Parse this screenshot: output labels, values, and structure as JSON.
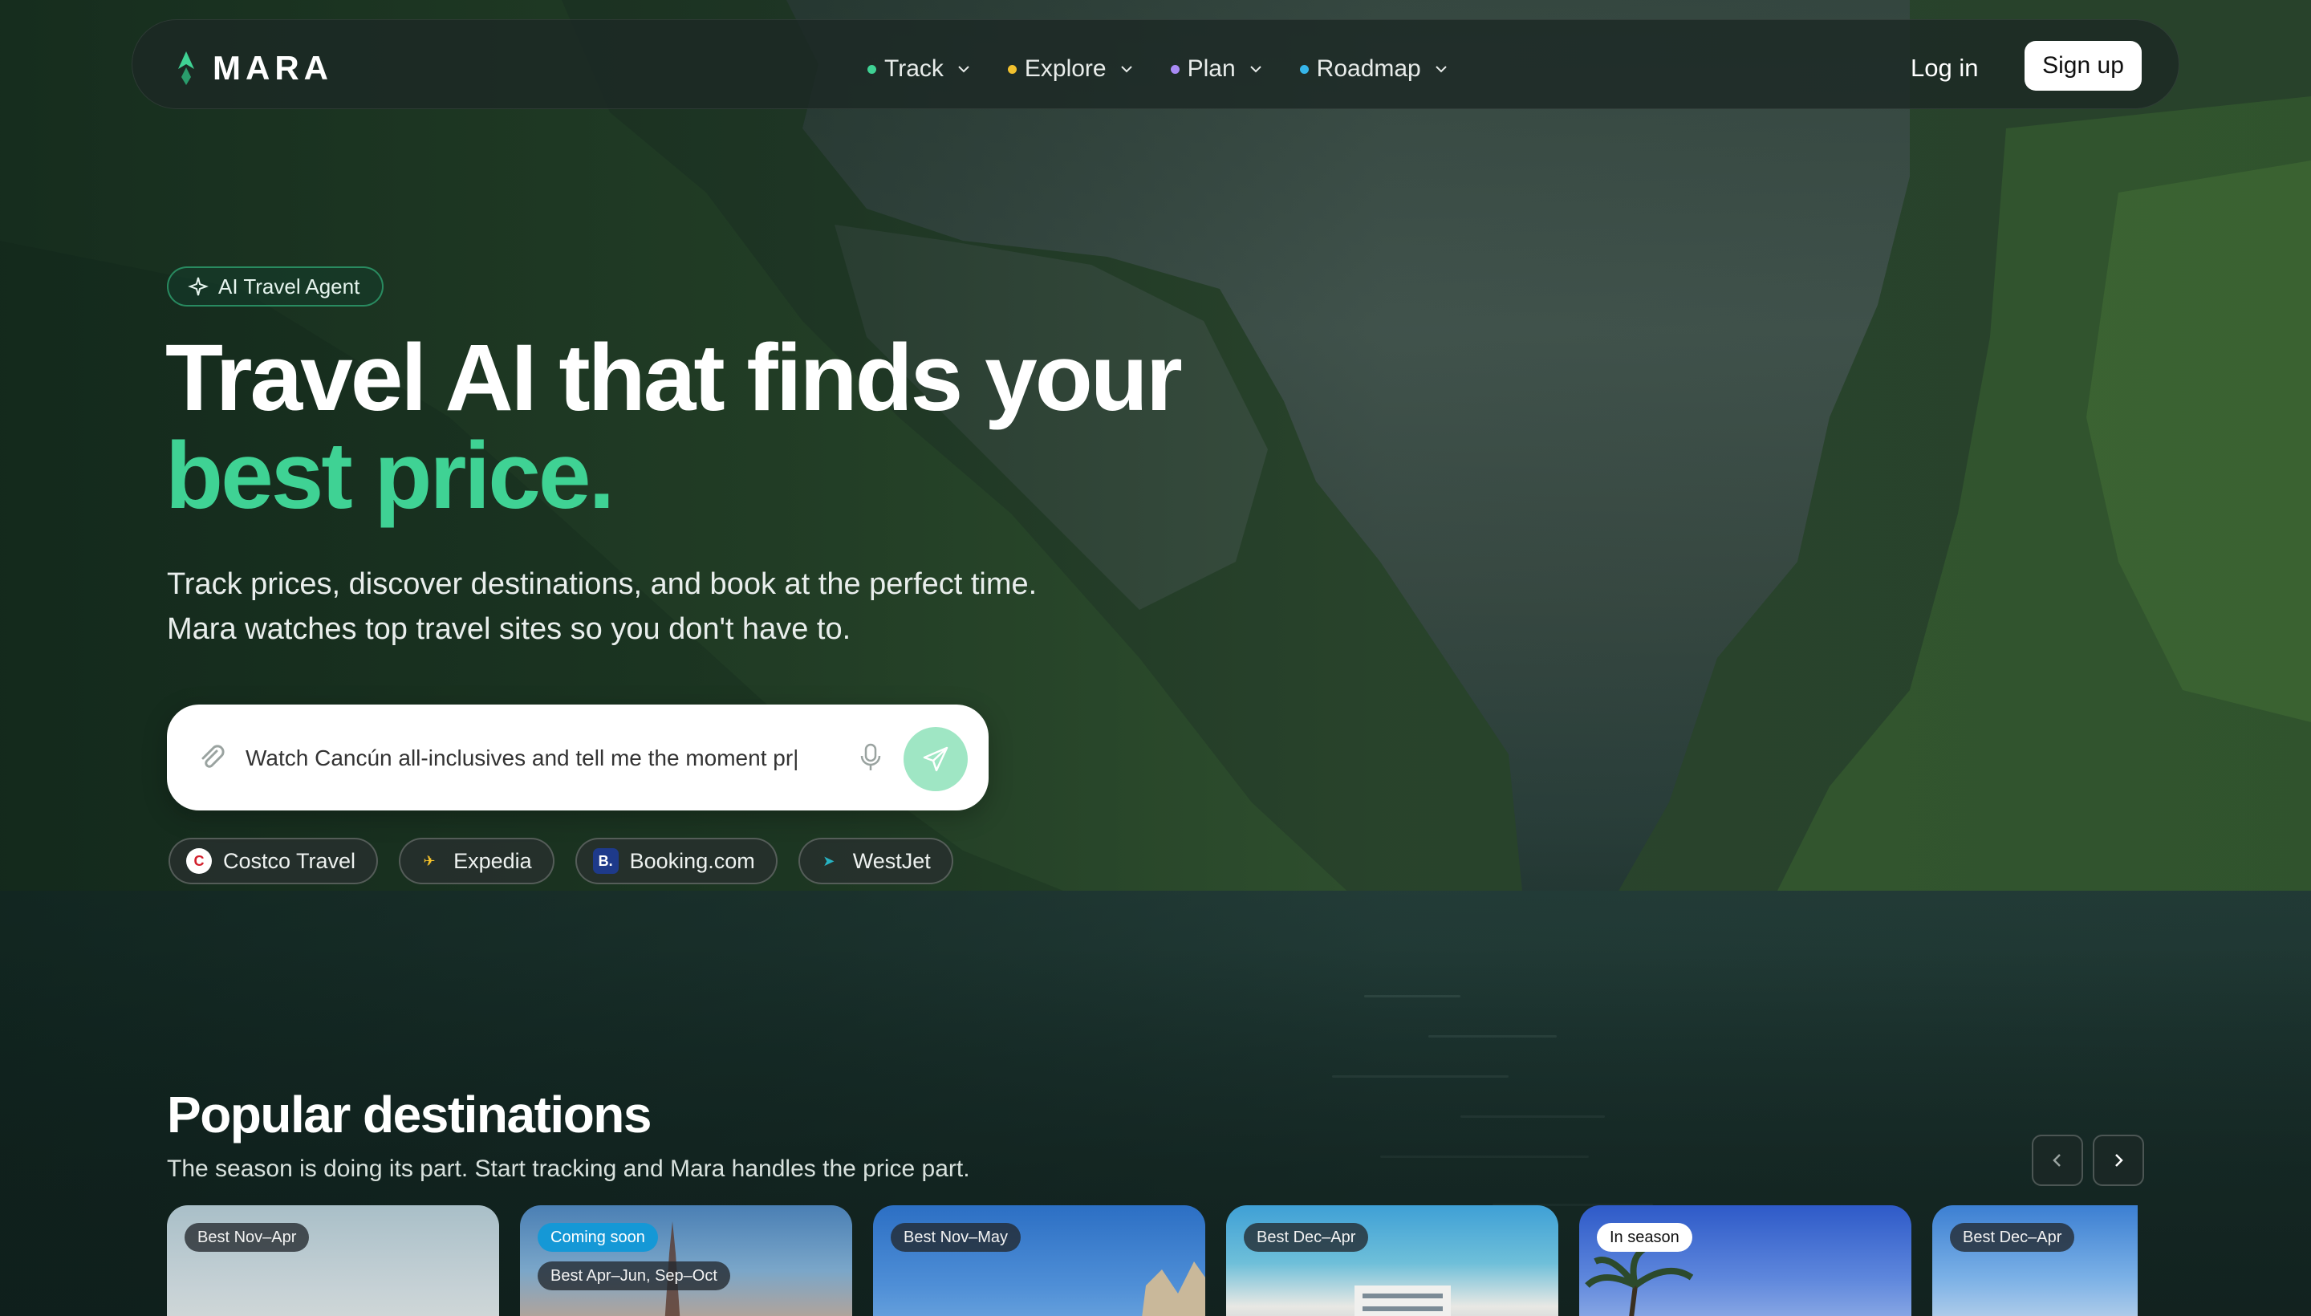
{
  "brand": {
    "name": "MARA"
  },
  "nav": {
    "items": [
      {
        "label": "Track",
        "color": "#3fd294"
      },
      {
        "label": "Explore",
        "color": "#f2c12e"
      },
      {
        "label": "Plan",
        "color": "#a98bf5"
      },
      {
        "label": "Roadmap",
        "color": "#36b6ea"
      }
    ],
    "login": "Log in",
    "signup": "Sign up"
  },
  "hero": {
    "badge": "AI Travel Agent",
    "title_line1": "Travel AI that finds your",
    "title_line2": "best price.",
    "subtitle": "Track prices, discover destinations, and book at the perfect time. Mara watches top travel sites so you don't have to.",
    "search_value": "Watch Cancún all-inclusives and tell me the moment pr|",
    "accent_color": "#3fd294"
  },
  "sites": [
    {
      "label": "Costco Travel",
      "icon": "costco-icon"
    },
    {
      "label": "Expedia",
      "icon": "expedia-icon"
    },
    {
      "label": "Booking.com",
      "icon": "booking-icon",
      "glyph": "B."
    },
    {
      "label": "WestJet",
      "icon": "westjet-icon"
    }
  ],
  "popular": {
    "title": "Popular destinations",
    "subtitle": "The season is doing its part. Start tracking and Mara handles the price part.",
    "cards": [
      {
        "tags": [
          {
            "text": "Best Nov–Apr",
            "style": "dark"
          }
        ]
      },
      {
        "tags": [
          {
            "text": "Coming soon",
            "style": "blue"
          },
          {
            "text": "Best Apr–Jun, Sep–Oct",
            "style": "dark"
          }
        ]
      },
      {
        "tags": [
          {
            "text": "Best Nov–May",
            "style": "dark"
          }
        ]
      },
      {
        "tags": [
          {
            "text": "Best Dec–Apr",
            "style": "dark"
          }
        ]
      },
      {
        "tags": [
          {
            "text": "In season",
            "style": "white"
          }
        ]
      },
      {
        "tags": [
          {
            "text": "Best Dec–Apr",
            "style": "dark"
          }
        ]
      }
    ]
  }
}
